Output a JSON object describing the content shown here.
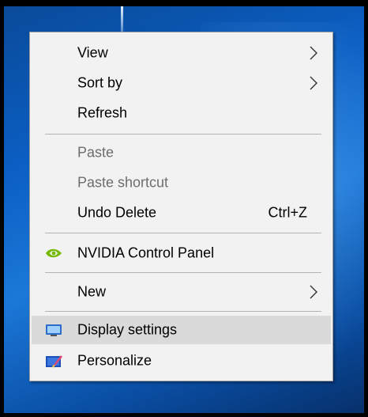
{
  "menu": {
    "view": {
      "label": "View",
      "icon": "chevron-right-icon"
    },
    "sort_by": {
      "label": "Sort by",
      "icon": "chevron-right-icon"
    },
    "refresh": {
      "label": "Refresh"
    },
    "paste": {
      "label": "Paste",
      "disabled": true
    },
    "paste_shortcut": {
      "label": "Paste shortcut",
      "disabled": true
    },
    "undo_delete": {
      "label": "Undo Delete",
      "shortcut": "Ctrl+Z"
    },
    "nvidia": {
      "label": "NVIDIA Control Panel",
      "icon": "nvidia-logo-icon",
      "icon_color": "#76b900"
    },
    "new": {
      "label": "New",
      "icon": "chevron-right-icon"
    },
    "display_settings": {
      "label": "Display settings",
      "icon": "monitor-icon",
      "highlighted": true
    },
    "personalize": {
      "label": "Personalize",
      "icon": "personalize-icon"
    }
  },
  "colors": {
    "menu_background": "#f2f2f2",
    "hover_background": "#dadada",
    "disabled_text": "#6d6d6d",
    "desktop_blue": "#0b5ec2"
  }
}
